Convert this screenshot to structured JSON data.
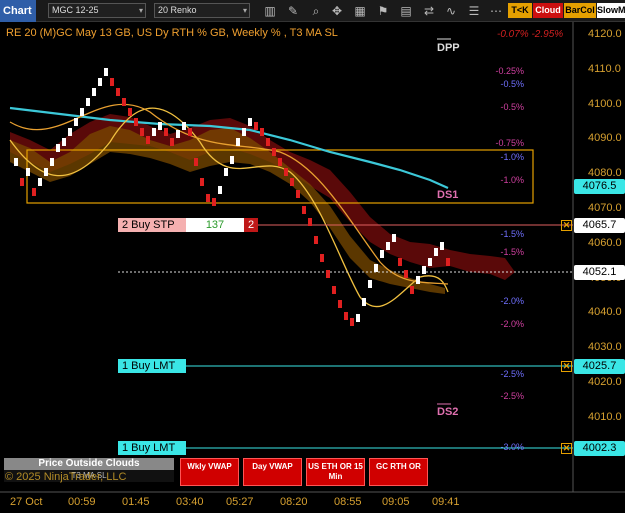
{
  "toolbar": {
    "tab_label": "Chart",
    "instrument": "MGC 12-25",
    "bar_type": "20 Renko",
    "btn_tk": "T<K",
    "btn_cloud": "Cloud",
    "btn_barcol": "BarCol",
    "btn_slow": "SlowM"
  },
  "chart": {
    "title": "RE 20  (M)GC May 13 GB, US Dy RTH % GB, Weekly % , T3 MA SL",
    "title_right": "-0.07% -2.95%",
    "levels": {
      "dpp": "DPP",
      "ds1": "DS1",
      "ds2": "DS2"
    }
  },
  "percent_labels": [
    {
      "text": "-0.25%",
      "color": "#d040a0"
    },
    {
      "text": "-0.5%",
      "color": "#7070ff"
    },
    {
      "text": "-0.5%",
      "color": "#d040a0"
    },
    {
      "text": "-0.75%",
      "color": "#d040a0"
    },
    {
      "text": "-1.0%",
      "color": "#7070ff"
    },
    {
      "text": "-1.0%",
      "color": "#d040a0"
    },
    {
      "text": "-1.5%",
      "color": "#7070ff"
    },
    {
      "text": "-1.5%",
      "color": "#d040a0"
    },
    {
      "text": "-2.0%",
      "color": "#7070ff"
    },
    {
      "text": "-2.0%",
      "color": "#d040a0"
    },
    {
      "text": "-2.5%",
      "color": "#7070ff"
    },
    {
      "text": "-2.5%",
      "color": "#d040a0"
    },
    {
      "text": "-3.0%",
      "color": "#7070ff"
    }
  ],
  "price_axis": [
    "4120.0",
    "4110.0",
    "4100.0",
    "4090.0",
    "4080.0",
    "4070.0",
    "4060.0",
    "4050.0",
    "4040.0",
    "4030.0",
    "4020.0",
    "4010.0",
    "4000.0"
  ],
  "price_markers": {
    "last": "4076.5",
    "stop": "4065.7",
    "current": "4052.1",
    "lmt1": "4025.7",
    "lmt2": "4002.3"
  },
  "orders": {
    "stop_label": "2 Buy STP",
    "stop_qty": "137",
    "stop_count": "2",
    "lmt1_label": "1 Buy LMT",
    "lmt2_label": "1 Buy LMT",
    "x_glyph": "✕"
  },
  "bottom": {
    "price_outside": "Price Outside Clouds",
    "t3": "T3 MA SL",
    "copyright": "© 2025 NinjaTrader, LLC",
    "btn_wkly": "Wkly VWAP",
    "btn_day": "Day VWAP",
    "btn_us": "US ETH OR 15 Min",
    "btn_gc": "GC RTH OR"
  },
  "time_axis": [
    "27 Oct",
    "00:59",
    "01:45",
    "03:40",
    "05:27",
    "08:20",
    "08:55",
    "09:05",
    "09:41"
  ],
  "colors": {
    "accent_orange": "#e5a000",
    "bull": "#ffffff",
    "bear": "#e02020",
    "ma_cyan": "#3cc8d8",
    "cloud": "#8a1010",
    "orange_box": "#e5a000"
  }
}
